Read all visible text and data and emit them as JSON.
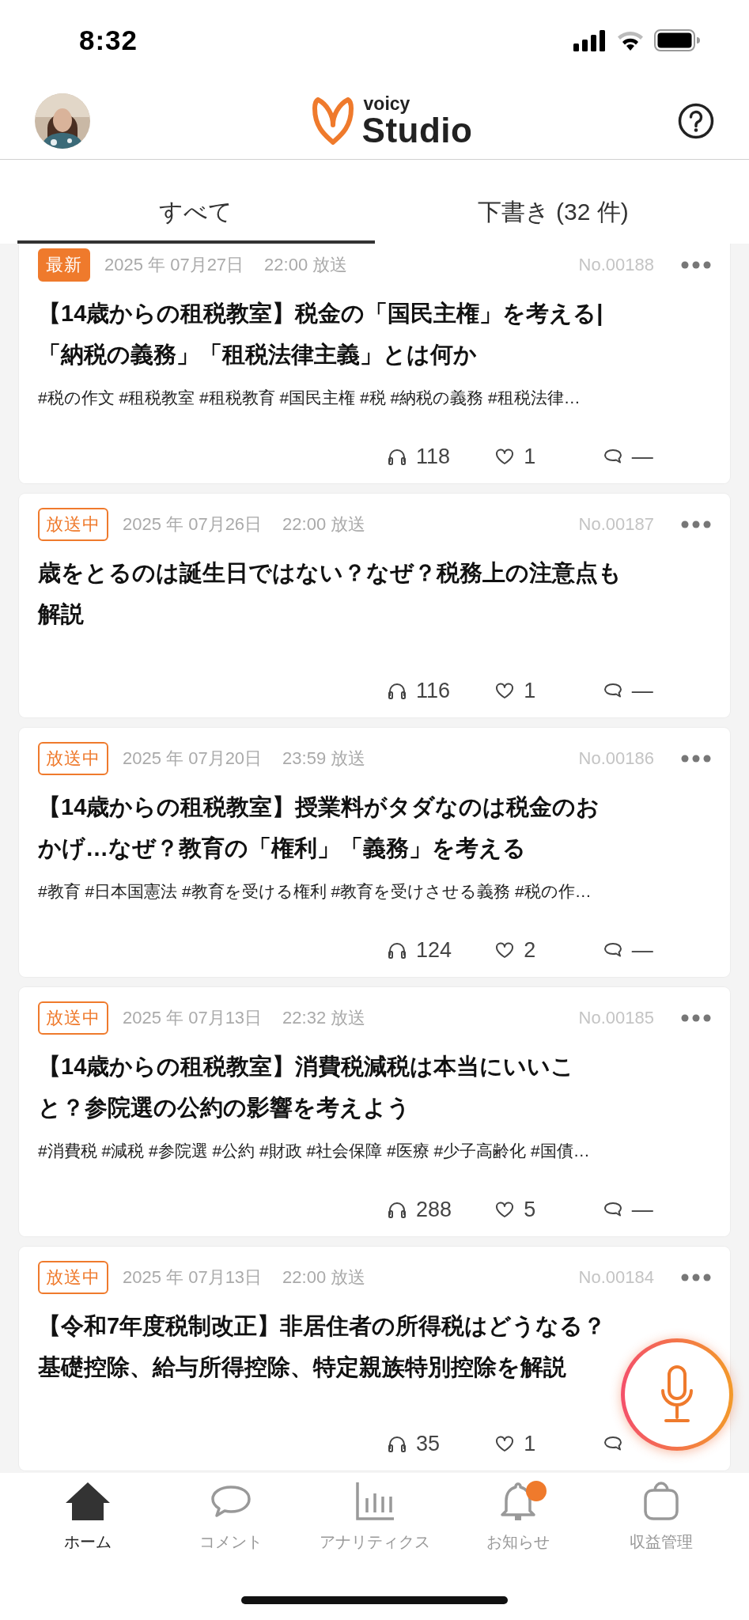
{
  "status_bar": {
    "time": "8:32"
  },
  "header": {
    "logo_small": "voicy",
    "logo_large": "Studio"
  },
  "tabs": [
    {
      "label": "すべて",
      "selected": true
    },
    {
      "label": "下書き (32 件)",
      "selected": false
    }
  ],
  "episodes": [
    {
      "badge": {
        "text": "最新",
        "kind": "new"
      },
      "date": "2025 年 07月27日",
      "time": "22:00 放送",
      "number": "No.00188",
      "title_lines": [
        "【14歳からの租税教室】税金の「国民主権」を考える|",
        "「納税の義務」「租税法律主義」とは何か"
      ],
      "tags": "#税の作文 #租税教室 #租税教育 #国民主権 #税 #納税の義務 #租税法律…",
      "plays": "118",
      "likes": "1",
      "comments": "—"
    },
    {
      "badge": {
        "text": "放送中",
        "kind": "live"
      },
      "date": "2025 年 07月26日",
      "time": "22:00 放送",
      "number": "No.00187",
      "title_lines": [
        "歳をとるのは誕生日ではない？なぜ？税務上の注意点も",
        "解説"
      ],
      "plays": "116",
      "likes": "1",
      "comments": "—"
    },
    {
      "badge": {
        "text": "放送中",
        "kind": "live"
      },
      "date": "2025 年 07月20日",
      "time": "23:59 放送",
      "number": "No.00186",
      "title_lines": [
        "【14歳からの租税教室】授業料がタダなのは税金のお",
        "かげ…なぜ？教育の「権利」「義務」を考える"
      ],
      "tags": "#教育 #日本国憲法 #教育を受ける権利 #教育を受けさせる義務 #税の作…",
      "plays": "124",
      "likes": "2",
      "comments": "—"
    },
    {
      "badge": {
        "text": "放送中",
        "kind": "live"
      },
      "date": "2025 年 07月13日",
      "time": "22:32 放送",
      "number": "No.00185",
      "title_lines": [
        "【14歳からの租税教室】消費税減税は本当にいいこ",
        "と？参院選の公約の影響を考えよう"
      ],
      "tags": "#消費税 #減税 #参院選 #公約 #財政 #社会保障 #医療 #少子高齢化 #国債…",
      "plays": "288",
      "likes": "5",
      "comments": "—"
    },
    {
      "badge": {
        "text": "放送中",
        "kind": "live"
      },
      "date": "2025 年 07月13日",
      "time": "22:00 放送",
      "number": "No.00184",
      "title_lines": [
        "【令和7年度税制改正】非居住者の所得税はどうなる？",
        "基礎控除、給与所得控除、特定親族特別控除を解説"
      ],
      "plays": "35",
      "likes": "1"
    }
  ],
  "nav": [
    {
      "kind": "home",
      "label": "ホーム",
      "selected": true,
      "notification": false
    },
    {
      "kind": "comment",
      "label": "コメント",
      "selected": false,
      "notification": false
    },
    {
      "kind": "analytics",
      "label": "アナリティクス",
      "selected": false,
      "notification": false
    },
    {
      "kind": "bell",
      "label": "お知らせ",
      "selected": false,
      "notification": true
    },
    {
      "kind": "purse",
      "label": "収益管理",
      "selected": false,
      "notification": false
    }
  ]
}
